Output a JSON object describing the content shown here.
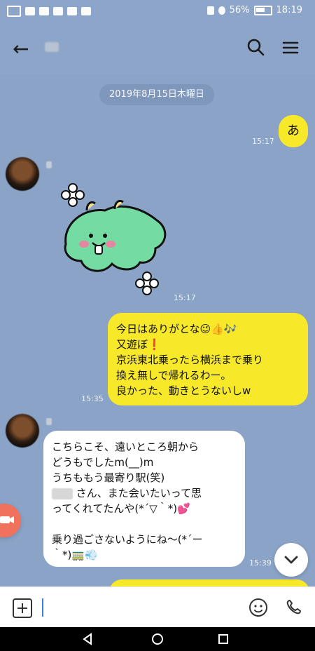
{
  "status": {
    "left_icons": [
      "hd-icon",
      "signal-icon",
      "wifi-icon",
      "eye-icon",
      "camera-icon",
      "p-icon"
    ],
    "battery_percent": "56%",
    "time": "18:19"
  },
  "topbar": {
    "back_icon": "back-arrow-icon",
    "search_icon": "search-icon",
    "menu_icon": "menu-icon"
  },
  "chat": {
    "date_pill": "2019年8月15日木曜日",
    "messages": [
      {
        "sender": "me",
        "type": "text",
        "text": "あ",
        "time": "15:17"
      },
      {
        "sender": "other",
        "type": "sticker",
        "time": "15:17"
      },
      {
        "sender": "me",
        "type": "text",
        "lines": [
          "今日はありがとな😉👍🎶",
          "又遊ぼ❗",
          "京浜東北乗ったら横浜まで乗り",
          "換え無しで帰れるわー。",
          "良かった、動きとうないしw"
        ],
        "time": "15:35"
      },
      {
        "sender": "other",
        "type": "text",
        "lines": [
          "こちらこそ、遠いところ朝から",
          "どうもでしたm(__)m",
          "うちももう最寄り駅(笑)",
          "さん、また会いたいって思",
          "ってくれてたんや(*´▽｀*)💕",
          "",
          "乗り過ごさないようにね〜(*´ー",
          "｀*)🚃💨"
        ],
        "time": "15:39"
      }
    ]
  },
  "input": {
    "plus_icon": "plus-icon",
    "emoji_icon": "emoji-icon",
    "call_icon": "phone-icon"
  },
  "colors": {
    "background": "#8aa3c6",
    "yellow_bubble": "#f7e829",
    "white_bubble": "#ffffff",
    "date_pill": "#7f97bb",
    "accent_red": "#f0725c"
  }
}
